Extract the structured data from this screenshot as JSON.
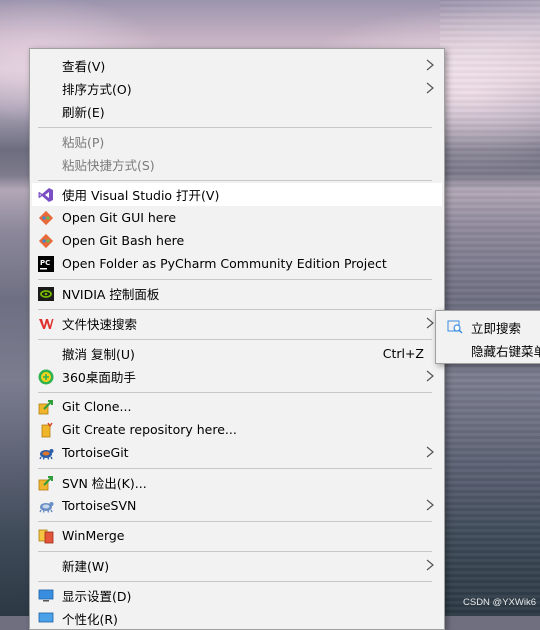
{
  "menu": {
    "items": [
      {
        "label": "查看(V)",
        "shortcut": "",
        "icon": "",
        "submenu": true,
        "disabled": false
      },
      {
        "label": "排序方式(O)",
        "shortcut": "",
        "icon": "",
        "submenu": true,
        "disabled": false
      },
      {
        "label": "刷新(E)",
        "shortcut": "",
        "icon": "",
        "submenu": false,
        "disabled": false
      },
      {
        "label": "粘贴(P)",
        "shortcut": "",
        "icon": "",
        "submenu": false,
        "disabled": true
      },
      {
        "label": "粘贴快捷方式(S)",
        "shortcut": "",
        "icon": "",
        "submenu": false,
        "disabled": true
      },
      {
        "label": "使用 Visual Studio 打开(V)",
        "shortcut": "",
        "icon": "visual-studio-icon",
        "submenu": false,
        "disabled": false,
        "highlighted": true
      },
      {
        "label": "Open Git GUI here",
        "shortcut": "",
        "icon": "git-gui-icon",
        "submenu": false,
        "disabled": false
      },
      {
        "label": "Open Git Bash here",
        "shortcut": "",
        "icon": "git-bash-icon",
        "submenu": false,
        "disabled": false
      },
      {
        "label": "Open Folder as PyCharm Community Edition Project",
        "shortcut": "",
        "icon": "pycharm-icon",
        "submenu": false,
        "disabled": false
      },
      {
        "label": "NVIDIA 控制面板",
        "shortcut": "",
        "icon": "nvidia-icon",
        "submenu": false,
        "disabled": false
      },
      {
        "label": "文件快速搜索",
        "shortcut": "",
        "icon": "wps-icon",
        "submenu": true,
        "disabled": false
      },
      {
        "label": "撤消 复制(U)",
        "shortcut": "Ctrl+Z",
        "icon": "",
        "submenu": false,
        "disabled": false
      },
      {
        "label": "360桌面助手",
        "shortcut": "",
        "icon": "360-icon",
        "submenu": true,
        "disabled": false
      },
      {
        "label": "Git Clone...",
        "shortcut": "",
        "icon": "git-clone-icon",
        "submenu": false,
        "disabled": false
      },
      {
        "label": "Git Create repository here...",
        "shortcut": "",
        "icon": "git-create-repo-icon",
        "submenu": false,
        "disabled": false
      },
      {
        "label": "TortoiseGit",
        "shortcut": "",
        "icon": "tortoisegit-icon",
        "submenu": true,
        "disabled": false
      },
      {
        "label": "SVN 检出(K)...",
        "shortcut": "",
        "icon": "svn-checkout-icon",
        "submenu": false,
        "disabled": false
      },
      {
        "label": "TortoiseSVN",
        "shortcut": "",
        "icon": "tortoisesvn-icon",
        "submenu": true,
        "disabled": false
      },
      {
        "label": "WinMerge",
        "shortcut": "",
        "icon": "winmerge-icon",
        "submenu": false,
        "disabled": false
      },
      {
        "label": "新建(W)",
        "shortcut": "",
        "icon": "",
        "submenu": true,
        "disabled": false
      },
      {
        "label": "显示设置(D)",
        "shortcut": "",
        "icon": "display-settings-icon",
        "submenu": false,
        "disabled": false
      },
      {
        "label": "个性化(R)",
        "shortcut": "",
        "icon": "personalize-icon",
        "submenu": false,
        "disabled": false
      }
    ]
  },
  "submenu": {
    "items": [
      {
        "label": "立即搜索",
        "icon": "search-folder-icon"
      },
      {
        "label": "隐藏右键菜单",
        "icon": ""
      }
    ]
  },
  "watermark": "CSDN @YXWik6",
  "colors": {
    "menu_bg": "#f2f2f2",
    "highlight_bg": "#ffffff",
    "disabled_text": "#7a7a7a",
    "separator": "#c8c8c8"
  }
}
